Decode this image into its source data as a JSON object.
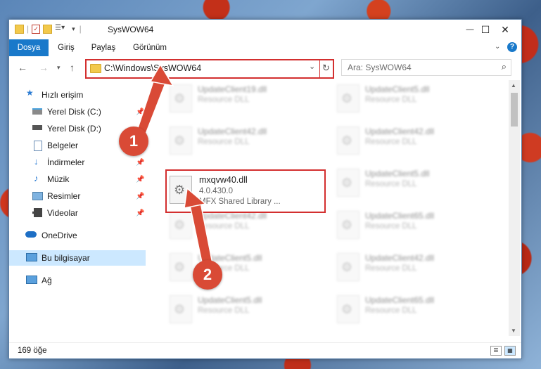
{
  "window": {
    "title": "SysWOW64",
    "controls": {
      "minimize": "—",
      "maximize": "☐",
      "close": "✕"
    }
  },
  "ribbon": {
    "tabs": [
      {
        "label": "Dosya",
        "active": true
      },
      {
        "label": "Giriş"
      },
      {
        "label": "Paylaş"
      },
      {
        "label": "Görünüm"
      }
    ],
    "help_icon": "?"
  },
  "navigation": {
    "address_path": "C:\\Windows\\SysWOW64",
    "search_placeholder": "Ara: SysWOW64"
  },
  "sidebar": {
    "items": [
      {
        "label": "Hızlı erişim",
        "icon": "star-icon"
      },
      {
        "label": "Yerel Disk (C:)",
        "icon": "drive-icon",
        "pinned": true
      },
      {
        "label": "Yerel Disk (D:)",
        "icon": "drive-icon"
      },
      {
        "label": "Belgeler",
        "icon": "documents-icon",
        "pinned": true
      },
      {
        "label": "İndirmeler",
        "icon": "download-icon",
        "pinned": true
      },
      {
        "label": "Müzik",
        "icon": "music-icon",
        "pinned": true
      },
      {
        "label": "Resimler",
        "icon": "pictures-icon",
        "pinned": true
      },
      {
        "label": "Videolar",
        "icon": "videos-icon",
        "pinned": true
      },
      {
        "label": "OneDrive",
        "icon": "cloud-icon"
      },
      {
        "label": "Bu bilgisayar",
        "icon": "computer-icon",
        "selected": true
      },
      {
        "label": "Ağ",
        "icon": "network-icon"
      }
    ]
  },
  "files": {
    "blurred": [
      {
        "name": "UpdateClient19.dll",
        "desc": "Resource DLL"
      },
      {
        "name": "UpdateClient5.dll",
        "desc": "Resource DLL"
      },
      {
        "name": "UpdateClient42.dll",
        "desc": "Resource DLL"
      },
      {
        "name": "UpdateClient42.dll",
        "desc": "Resource DLL"
      },
      {
        "name": "UpdateClient5.dll",
        "desc": "Resource DLL"
      },
      {
        "name": "UpdateClient42.dll",
        "desc": "Resource DLL"
      },
      {
        "name": "UpdateClient65.dll",
        "desc": "Resource DLL"
      },
      {
        "name": "UpdateClient5.dll",
        "desc": "Resource DLL"
      },
      {
        "name": "UpdateClient42.dll",
        "desc": "Resource DLL"
      },
      {
        "name": "UpdateClient5.dll",
        "desc": "Resource DLL"
      },
      {
        "name": "UpdateClient65.dll",
        "desc": "Resource DLL"
      }
    ],
    "highlighted": {
      "name": "mxqvw40.dll",
      "version": "4.0.430.0",
      "description": "MFX Shared Library ..."
    }
  },
  "annotations": {
    "step1": "1",
    "step2": "2"
  },
  "status": {
    "item_count": "169 öğe"
  },
  "colors": {
    "accent": "#1979ca",
    "highlight": "#d32f2f",
    "badge": "#d94a36",
    "selection": "#cce8ff"
  }
}
